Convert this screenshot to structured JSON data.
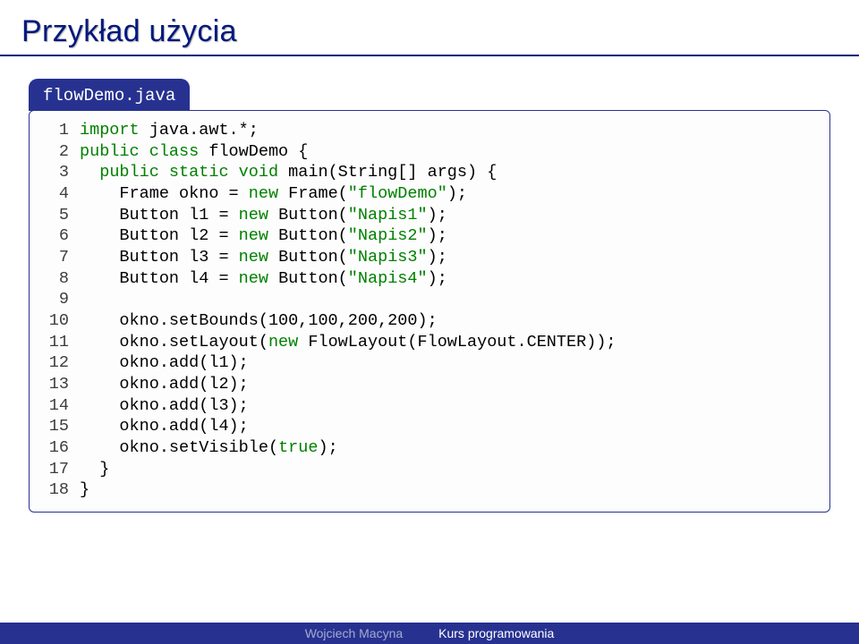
{
  "title": "Przykład użycia",
  "file_tab": "flowDemo.java",
  "footer": {
    "author": "Wojciech Macyna",
    "course": "Kurs programowania"
  },
  "code": {
    "lines": [
      {
        "n": "1",
        "pre": "",
        "t": [
          [
            "g",
            "import"
          ],
          [
            "p",
            " java.awt.*;"
          ]
        ]
      },
      {
        "n": "2",
        "pre": "",
        "t": [
          [
            "g",
            "public class"
          ],
          [
            "p",
            " flowDemo {"
          ]
        ]
      },
      {
        "n": "3",
        "pre": "  ",
        "t": [
          [
            "g",
            "public static void"
          ],
          [
            "p",
            " main(String[] args) {"
          ]
        ]
      },
      {
        "n": "4",
        "pre": "    ",
        "t": [
          [
            "p",
            "Frame okno = "
          ],
          [
            "g",
            "new"
          ],
          [
            "p",
            " Frame("
          ],
          [
            "g",
            "\"flowDemo\""
          ],
          [
            "p",
            ");"
          ]
        ]
      },
      {
        "n": "5",
        "pre": "    ",
        "t": [
          [
            "p",
            "Button l1 = "
          ],
          [
            "g",
            "new"
          ],
          [
            "p",
            " Button("
          ],
          [
            "g",
            "\"Napis1\""
          ],
          [
            "p",
            ");"
          ]
        ]
      },
      {
        "n": "6",
        "pre": "    ",
        "t": [
          [
            "p",
            "Button l2 = "
          ],
          [
            "g",
            "new"
          ],
          [
            "p",
            " Button("
          ],
          [
            "g",
            "\"Napis2\""
          ],
          [
            "p",
            ");"
          ]
        ]
      },
      {
        "n": "7",
        "pre": "    ",
        "t": [
          [
            "p",
            "Button l3 = "
          ],
          [
            "g",
            "new"
          ],
          [
            "p",
            " Button("
          ],
          [
            "g",
            "\"Napis3\""
          ],
          [
            "p",
            ");"
          ]
        ]
      },
      {
        "n": "8",
        "pre": "    ",
        "t": [
          [
            "p",
            "Button l4 = "
          ],
          [
            "g",
            "new"
          ],
          [
            "p",
            " Button("
          ],
          [
            "g",
            "\"Napis4\""
          ],
          [
            "p",
            ");"
          ]
        ]
      },
      {
        "n": "9",
        "pre": "",
        "t": []
      },
      {
        "n": "10",
        "pre": "    ",
        "t": [
          [
            "p",
            "okno.setBounds(100,100,200,200);"
          ]
        ]
      },
      {
        "n": "11",
        "pre": "    ",
        "t": [
          [
            "p",
            "okno.setLayout("
          ],
          [
            "g",
            "new"
          ],
          [
            "p",
            " FlowLayout(FlowLayout.CENTER));"
          ]
        ]
      },
      {
        "n": "12",
        "pre": "    ",
        "t": [
          [
            "p",
            "okno.add(l1);"
          ]
        ]
      },
      {
        "n": "13",
        "pre": "    ",
        "t": [
          [
            "p",
            "okno.add(l2);"
          ]
        ]
      },
      {
        "n": "14",
        "pre": "    ",
        "t": [
          [
            "p",
            "okno.add(l3);"
          ]
        ]
      },
      {
        "n": "15",
        "pre": "    ",
        "t": [
          [
            "p",
            "okno.add(l4);"
          ]
        ]
      },
      {
        "n": "16",
        "pre": "    ",
        "t": [
          [
            "p",
            "okno.setVisible("
          ],
          [
            "g",
            "true"
          ],
          [
            "p",
            ");"
          ]
        ]
      },
      {
        "n": "17",
        "pre": "  ",
        "t": [
          [
            "p",
            "}"
          ]
        ]
      },
      {
        "n": "18",
        "pre": "",
        "t": [
          [
            "p",
            "}"
          ]
        ]
      }
    ]
  }
}
